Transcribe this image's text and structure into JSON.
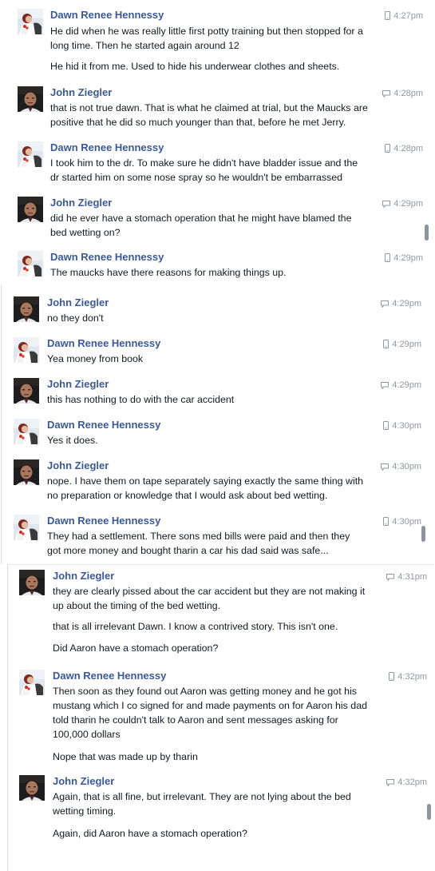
{
  "people": {
    "dawn": "Dawn Renee Hennessy",
    "john": "John Ziegler"
  },
  "panels": [
    {
      "messages": [
        {
          "sender": "Dawn Renee Hennessy",
          "avatar": "dawn",
          "time": "4:27pm",
          "device": "mobile-icon",
          "lines": [
            "He did when he was really little first potty training but then stopped for a",
            "long time. Then he started again around 12",
            "He hid it from me. Used to hide his underwear clothes and sheets."
          ]
        },
        {
          "sender": "John Ziegler",
          "avatar": "john",
          "time": "4:28pm",
          "device": "chat-icon",
          "lines": [
            "that is not true dawn. That is what he claimed at trial, but the Maucks are",
            "positive that he did so much younger than that, before he met Jerry."
          ]
        },
        {
          "sender": "Dawn Renee Hennessy",
          "avatar": "dawn",
          "time": "4:28pm",
          "device": "mobile-icon",
          "lines": [
            "I took him to the dr. To make sure he didn't have bladder issue and the",
            "dr started him on some nose spray so he wouldn't be embarrassed"
          ]
        },
        {
          "sender": "John Ziegler",
          "avatar": "john",
          "time": "4:29pm",
          "device": "chat-icon",
          "lines": [
            "did he ever have a stomach operation that he might have blamed the",
            "bed wetting on?"
          ]
        },
        {
          "sender": "Dawn Renee Hennessy",
          "avatar": "dawn",
          "time": "4:29pm",
          "device": "mobile-icon",
          "lines": [
            "The maucks have there reasons for making things up."
          ]
        }
      ]
    },
    {
      "messages": [
        {
          "sender": "John Ziegler",
          "avatar": "john",
          "time": "4:29pm",
          "device": "chat-icon",
          "lines": [
            "no they don't"
          ]
        },
        {
          "sender": "Dawn Renee Hennessy",
          "avatar": "dawn",
          "time": "4:29pm",
          "device": "mobile-icon",
          "lines": [
            "Yea money from book"
          ]
        },
        {
          "sender": "John Ziegler",
          "avatar": "john",
          "time": "4:29pm",
          "device": "chat-icon",
          "lines": [
            "this has nothing to do with the car accident"
          ]
        },
        {
          "sender": "Dawn Renee Hennessy",
          "avatar": "dawn",
          "time": "4:30pm",
          "device": "mobile-icon",
          "lines": [
            "Yes it does."
          ]
        },
        {
          "sender": "John Ziegler",
          "avatar": "john",
          "time": "4:30pm",
          "device": "chat-icon",
          "lines": [
            "nope. I have them on tape separately saying exactly the same thing with",
            "no preparation or knowledge that I would ask about bed wetting."
          ]
        },
        {
          "sender": "Dawn Renee Hennessy",
          "avatar": "dawn",
          "time": "4:30pm",
          "device": "mobile-icon",
          "lines": [
            "They had a settlement. There sons med bills were paid and then they",
            "got more money and bought tharin a car his dad said was safe..."
          ]
        }
      ]
    },
    {
      "messages": [
        {
          "sender": "John Ziegler",
          "avatar": "john",
          "time": "4:31pm",
          "device": "chat-icon",
          "lines": [
            "they are clearly pissed about the car accident but they are not making it",
            "up about the timing of the bed wetting.",
            "that is all irrelevant Dawn. I know a contrived story. This isn't one.",
            "Did Aaron have a stomach operation?"
          ]
        },
        {
          "sender": "Dawn Renee Hennessy",
          "avatar": "dawn",
          "time": "4:32pm",
          "device": "mobile-icon",
          "lines": [
            "Then soon as they found out Aaron was getting money and he got his",
            "mustang which I co signed for and made payments on for Aaron  his dad",
            "told tharin he couldn't talk to Aaron and sent messages asking for",
            "100,000 dollars",
            "Nope that was made up by tharin"
          ]
        },
        {
          "sender": "John Ziegler",
          "avatar": "john",
          "time": "4:32pm",
          "device": "chat-icon",
          "lines": [
            "Again, that is all fine, but irrelevant. They are not lying about the bed",
            "wetting timing.",
            "Again, did Aaron have a stomach operation?"
          ]
        }
      ]
    }
  ]
}
